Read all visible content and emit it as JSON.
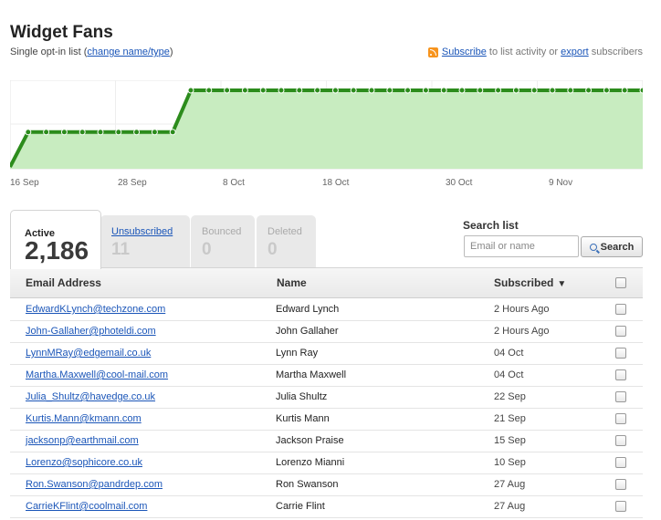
{
  "header": {
    "title": "Widget Fans",
    "subtitle_prefix": "Single opt-in list (",
    "subtitle_link": "change name/type",
    "subtitle_suffix": ")",
    "subscribe_link": "Subscribe",
    "subscribe_text": " to list activity or ",
    "export_link": "export",
    "export_text": " subscribers"
  },
  "chart_data": {
    "type": "area",
    "xlabels": [
      "16 Sep",
      "28 Sep",
      "8 Oct",
      "18 Oct",
      "30 Oct",
      "9 Nov"
    ],
    "values": [
      2120,
      2150,
      2150,
      2150,
      2150,
      2150,
      2150,
      2150,
      2150,
      2150,
      2186,
      2186,
      2186,
      2186,
      2186,
      2186,
      2186,
      2186,
      2186,
      2186,
      2186,
      2186,
      2186,
      2186,
      2186,
      2186,
      2186,
      2186,
      2186,
      2186,
      2186,
      2186,
      2186,
      2186,
      2186,
      2186
    ],
    "ylim": [
      2120,
      2186
    ],
    "grid": true,
    "line_color": "#2c8c1c",
    "fill_color": "#c8ecc0"
  },
  "tabs": [
    {
      "label": "Active",
      "count": "2,186",
      "active": true
    },
    {
      "label": "Unsubscribed",
      "count": "11",
      "active": false
    },
    {
      "label": "Bounced",
      "count": "0",
      "active": false
    },
    {
      "label": "Deleted",
      "count": "0",
      "active": false
    }
  ],
  "search": {
    "label": "Search list",
    "placeholder": "Email or name",
    "button": "Search"
  },
  "table": {
    "headers": {
      "email": "Email Address",
      "name": "Name",
      "subscribed": "Subscribed"
    },
    "sort_indicator": "▼",
    "rows": [
      {
        "email": "EdwardKLynch@techzone.com",
        "name": "Edward Lynch",
        "subscribed": "2 Hours Ago"
      },
      {
        "email": "John-Gallaher@photeldi.com",
        "name": "John Gallaher",
        "subscribed": "2 Hours Ago"
      },
      {
        "email": "LynnMRay@edgemail.co.uk",
        "name": "Lynn Ray",
        "subscribed": "04 Oct"
      },
      {
        "email": "Martha.Maxwell@cool-mail.com",
        "name": "Martha Maxwell",
        "subscribed": "04 Oct"
      },
      {
        "email": "Julia_Shultz@havedge.co.uk",
        "name": "Julia Shultz",
        "subscribed": "22 Sep"
      },
      {
        "email": "Kurtis.Mann@kmann.com",
        "name": "Kurtis Mann",
        "subscribed": "21 Sep"
      },
      {
        "email": "jacksonp@earthmail.com",
        "name": "Jackson Praise",
        "subscribed": "15 Sep"
      },
      {
        "email": "Lorenzo@sophicore.co.uk",
        "name": "Lorenzo Mianni",
        "subscribed": "10 Sep"
      },
      {
        "email": "Ron.Swanson@pandrdep.com",
        "name": "Ron Swanson",
        "subscribed": "27 Aug"
      },
      {
        "email": "CarrieKFlint@coolmail.com",
        "name": "Carrie Flint",
        "subscribed": "27 Aug"
      }
    ]
  }
}
